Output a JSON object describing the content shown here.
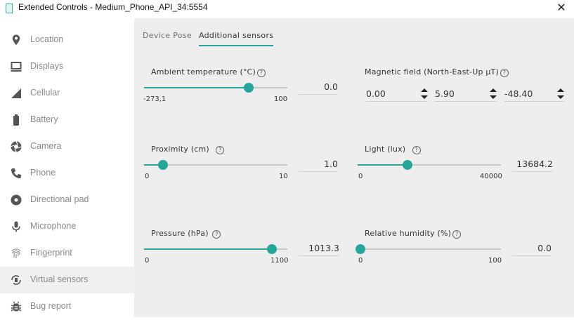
{
  "window": {
    "title": "Extended Controls - Medium_Phone_API_34:5554",
    "close_glyph": "✕"
  },
  "sidebar": {
    "items": [
      {
        "label": "Location",
        "icon": "location-pin-icon"
      },
      {
        "label": "Displays",
        "icon": "monitor-icon"
      },
      {
        "label": "Cellular",
        "icon": "signal-icon"
      },
      {
        "label": "Battery",
        "icon": "battery-icon"
      },
      {
        "label": "Camera",
        "icon": "camera-aperture-icon"
      },
      {
        "label": "Phone",
        "icon": "phone-icon"
      },
      {
        "label": "Directional pad",
        "icon": "dpad-icon"
      },
      {
        "label": "Microphone",
        "icon": "microphone-icon"
      },
      {
        "label": "Fingerprint",
        "icon": "fingerprint-icon"
      },
      {
        "label": "Virtual sensors",
        "icon": "rotation-icon",
        "active": true
      },
      {
        "label": "Bug report",
        "icon": "bug-icon"
      }
    ]
  },
  "tabs": [
    {
      "label": "Device Pose",
      "active": false
    },
    {
      "label": "Additional sensors",
      "active": true
    }
  ],
  "sensors": {
    "ambient_temperature": {
      "label": "Ambient temperature (°C)",
      "min": "-273,1",
      "max": "100",
      "value": "0.0",
      "level": 0.73
    },
    "magnetic_field": {
      "label": "Magnetic field (North-East-Up μT)",
      "x": "0.00",
      "y": "5.90",
      "z": "-48.40"
    },
    "proximity": {
      "label": "Proximity (cm)",
      "min": "0",
      "max": "10",
      "value": "1.0",
      "level": 0.13
    },
    "light": {
      "label": "Light (lux)",
      "min": "0",
      "max": "40000",
      "value": "13684.2",
      "level": 0.35
    },
    "pressure": {
      "label": "Pressure (hPa)",
      "min": "0",
      "max": "1100",
      "value": "1013.3",
      "level": 0.89
    },
    "relative_humidity": {
      "label": "Relative humidity (%)",
      "min": "0",
      "max": "100",
      "value": "0.0",
      "level": 0.02
    }
  },
  "help_glyph": "?",
  "colors": {
    "accent": "#26a69a",
    "sidebar_text": "#8a8a8a",
    "panel_bg": "#eeeeee"
  }
}
